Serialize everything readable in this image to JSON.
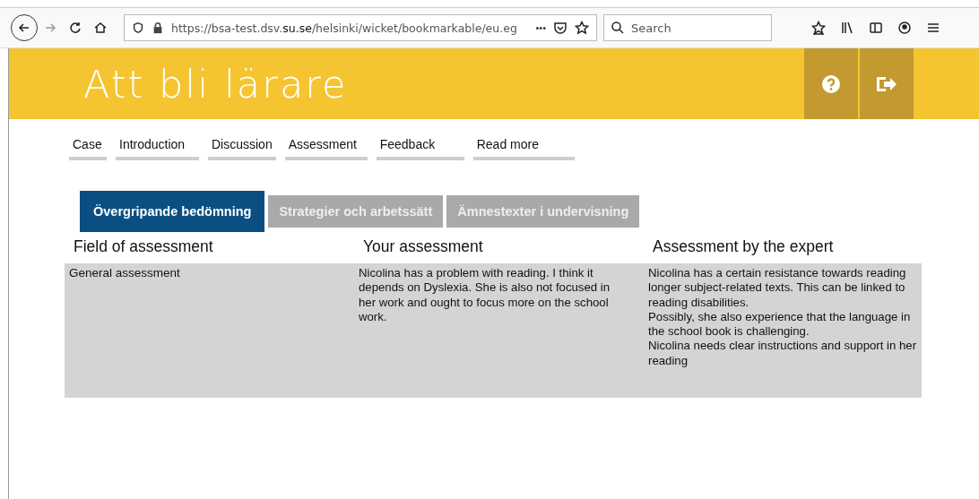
{
  "browser": {
    "url_prefix": "https://bsa-test.dsv.",
    "url_domain": "su.se",
    "url_rest": "/helsinki/wicket/bookmarkable/eu.eg",
    "url_more": "•••",
    "search": {
      "placeholder": "Search"
    }
  },
  "header": {
    "title": "Att bli lärare"
  },
  "nav": [
    {
      "label": "Case"
    },
    {
      "label": "Introduction"
    },
    {
      "label": "Discussion"
    },
    {
      "label": "Assessment"
    },
    {
      "label": "Feedback"
    },
    {
      "label": "Read more"
    }
  ],
  "tabs": [
    {
      "label": "Övergripande bedömning",
      "selected": true
    },
    {
      "label": "Strategier och arbetssätt",
      "selected": false
    },
    {
      "label": "Ämnestexter i undervisning",
      "selected": false
    }
  ],
  "table": {
    "columns": [
      "Field of assessment",
      "Your assessment",
      "Assessment by the expert"
    ],
    "rows": [
      {
        "field": "General assessment",
        "yours": [
          "Nicolina has a problem with reading. I think it depends on Dyslexia. She is also not focused in her work and ought to focus more on the school work."
        ],
        "expert": [
          "Nicolina has a certain resistance towards reading longer subject-related texts. This can be linked to reading disabilities.",
          "Possibly, she also experience that the language in the school book is challenging.",
          "Nicolina needs clear instructions and support in her reading"
        ]
      }
    ]
  }
}
